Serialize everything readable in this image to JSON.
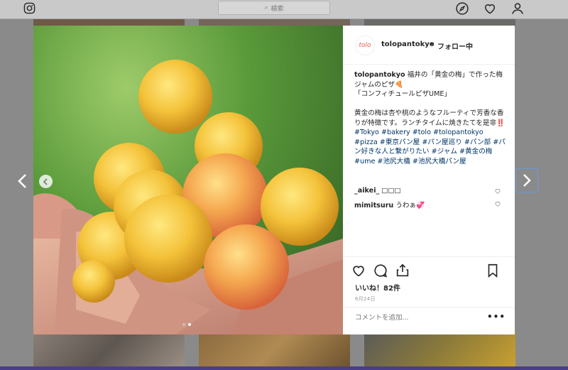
{
  "nav": {
    "search_placeholder": "検索",
    "icons": [
      "instagram-icon",
      "compass-icon",
      "heart-icon",
      "profile-icon"
    ]
  },
  "post": {
    "username": "tolopantokyo",
    "separator": "•",
    "follow_status": "フォロー中",
    "avatar_text": "tolo",
    "caption_user": "tolopantokyo",
    "caption_line1": "福井の「黄金の梅」で作った梅ジャムのピザ🍕",
    "caption_line2": "「コンフィチュールピザUME」",
    "caption_body": "黄金の梅は杏や桃のようなフルーティで芳香な香りが特徴です。ランチタイムに焼きたてを是非‼️",
    "hashtags": "#Tokyo #bakery #tolo #tolopantokyo #pizza #東京パン屋 #パン屋巡り #パン部 #パン好きな人と繋がりたい #ジャム #黄金の梅 #ume #池尻大橋 #池尻大橋パン屋",
    "comments": [
      {
        "user": "_aikei_",
        "text": "□□□"
      },
      {
        "user": "mimitsuru",
        "text": "うわぁ💞"
      }
    ],
    "likes": "いいね！82件",
    "date": "6月24日",
    "comment_placeholder": "コメントを追加...",
    "more": "•••"
  },
  "colors": {
    "accent_link": "#003569",
    "nav_bg": "#c9c9c9",
    "overlay": "#8a8a8a",
    "bottom_bar": "#4a3d8a"
  }
}
